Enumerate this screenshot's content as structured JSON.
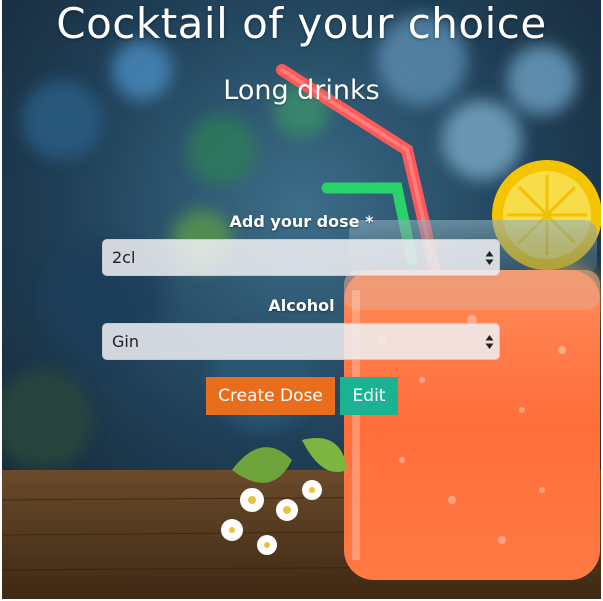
{
  "page": {
    "title": "Cocktail of your choice",
    "subtitle": "Long drinks"
  },
  "form": {
    "dose_label": "Add your dose *",
    "dose_value": "2cl",
    "alcohol_label": "Alcohol",
    "alcohol_value": "Gin"
  },
  "buttons": {
    "create_label": "Create Dose",
    "edit_label": "Edit"
  },
  "colors": {
    "create_button": "#e86d1c",
    "edit_button": "#19b394"
  },
  "icons": [
    "select-arrows-icon"
  ]
}
